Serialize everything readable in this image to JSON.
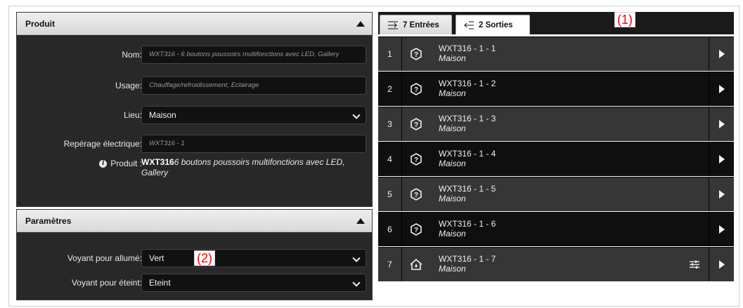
{
  "produit_panel": {
    "title": "Produit",
    "nom_label": "Nom:",
    "nom_value": "WXT316 - 6 boutons poussoirs multifonctions avec LED, Gallery",
    "usage_label": "Usage:",
    "usage_value": "Chauffage/refroidissement, Eclairage",
    "lieu_label": "Lieu:",
    "lieu_value": "Maison",
    "reperage_label": "Repérage électrique:",
    "reperage_value": "WXT316 - 1",
    "produit_label": "Produit :",
    "produit_code": "WXT316",
    "produit_desc": "6 boutons poussoirs multifonctions avec LED, Gallery"
  },
  "parametres_panel": {
    "title": "Paramètres",
    "voyant_allume_label": "Voyant pour allumé:",
    "voyant_allume_value": "Vert",
    "voyant_eteint_label": "Voyant pour éteint:",
    "voyant_eteint_value": "Eteint"
  },
  "tabs": {
    "entrees": "7 Entrées",
    "sorties": "2 Sorties"
  },
  "annotations": {
    "a1": "(1)",
    "a2": "(2)"
  },
  "entries": [
    {
      "num": "1",
      "name": "WXT316 - 1 - 1",
      "location": "Maison",
      "icon": "question-icon"
    },
    {
      "num": "2",
      "name": "WXT316 - 1 - 2",
      "location": "Maison",
      "icon": "question-icon"
    },
    {
      "num": "3",
      "name": "WXT316 - 1 - 3",
      "location": "Maison",
      "icon": "question-icon"
    },
    {
      "num": "4",
      "name": "WXT316 - 1 - 4",
      "location": "Maison",
      "icon": "question-icon"
    },
    {
      "num": "5",
      "name": "WXT316 - 1 - 5",
      "location": "Maison",
      "icon": "question-icon"
    },
    {
      "num": "6",
      "name": "WXT316 - 1 - 6",
      "location": "Maison",
      "icon": "question-icon"
    },
    {
      "num": "7",
      "name": "WXT316 - 1 - 7",
      "location": "Maison",
      "icon": "house-drop-icon"
    }
  ]
}
